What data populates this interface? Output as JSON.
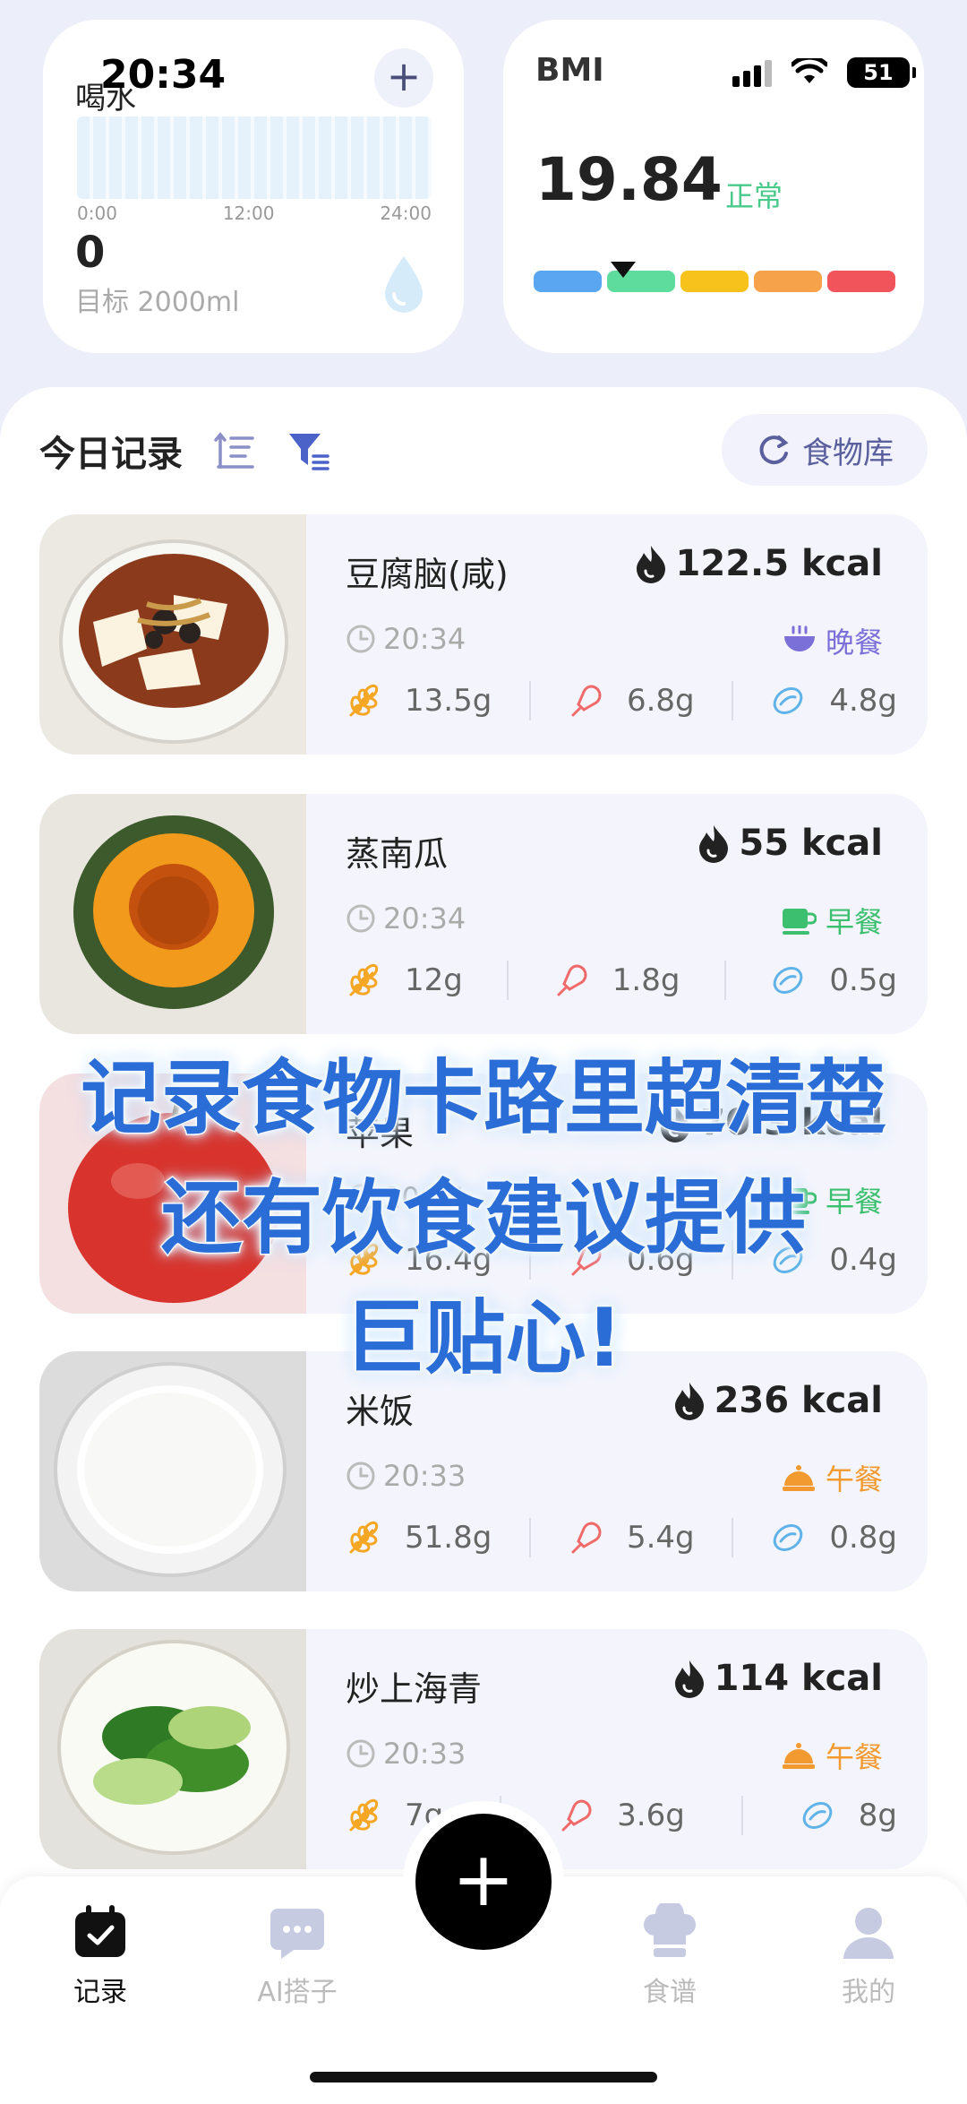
{
  "status_bar": {
    "time": "20:34",
    "battery": "51"
  },
  "water_card": {
    "title": "喝水",
    "axis": [
      "0:00",
      "12:00",
      "24:00"
    ],
    "value": "0",
    "goal": "目标 2000ml"
  },
  "bmi_card": {
    "title": "BMI",
    "value": "19.84",
    "status": "正常",
    "bar_colors": [
      "#5aa6f0",
      "#5edc9e",
      "#f6c21b",
      "#f6a24a",
      "#f2545b"
    ]
  },
  "records_header": {
    "title": "今日记录",
    "food_library": "食物库"
  },
  "records": [
    {
      "name": "豆腐脑(咸)",
      "kcal": "122.5 kcal",
      "time": "20:34",
      "meal": "晚餐",
      "meal_color": "#7b6fd8",
      "carb": "13.5g",
      "protein": "6.8g",
      "fat": "4.8g"
    },
    {
      "name": "蒸南瓜",
      "kcal": "55 kcal",
      "time": "20:34",
      "meal": "早餐",
      "meal_color": "#3cc070",
      "carb": "12g",
      "protein": "1.8g",
      "fat": "0.5g"
    },
    {
      "name": "苹果",
      "kcal": "70.3 kcal",
      "time": "20:34",
      "meal": "早餐",
      "meal_color": "#3cc070",
      "carb": "16.4g",
      "protein": "0.6g",
      "fat": "0.4g"
    },
    {
      "name": "米饭",
      "kcal": "236 kcal",
      "time": "20:33",
      "meal": "午餐",
      "meal_color": "#f29a30",
      "carb": "51.8g",
      "protein": "5.4g",
      "fat": "0.8g"
    },
    {
      "name": "炒上海青",
      "kcal": "114 kcal",
      "time": "20:33",
      "meal": "午餐",
      "meal_color": "#f29a30",
      "carb": "7g",
      "protein": "3.6g",
      "fat": "8g"
    }
  ],
  "caption": {
    "line1": "记录食物卡路里超清楚",
    "line2": "还有饮食建议提供",
    "line3": "巨贴心!"
  },
  "fab": "+",
  "tabs": [
    {
      "label": "记录",
      "icon": "calendar-check-icon"
    },
    {
      "label": "AI搭子",
      "icon": "chat-bubble-icon"
    },
    {
      "label": "食谱",
      "icon": "chef-hat-icon"
    },
    {
      "label": "我的",
      "icon": "person-icon"
    }
  ],
  "colors": {
    "carb": "#f5a623",
    "protein": "#f06a6a",
    "fat": "#5fb3e8"
  }
}
